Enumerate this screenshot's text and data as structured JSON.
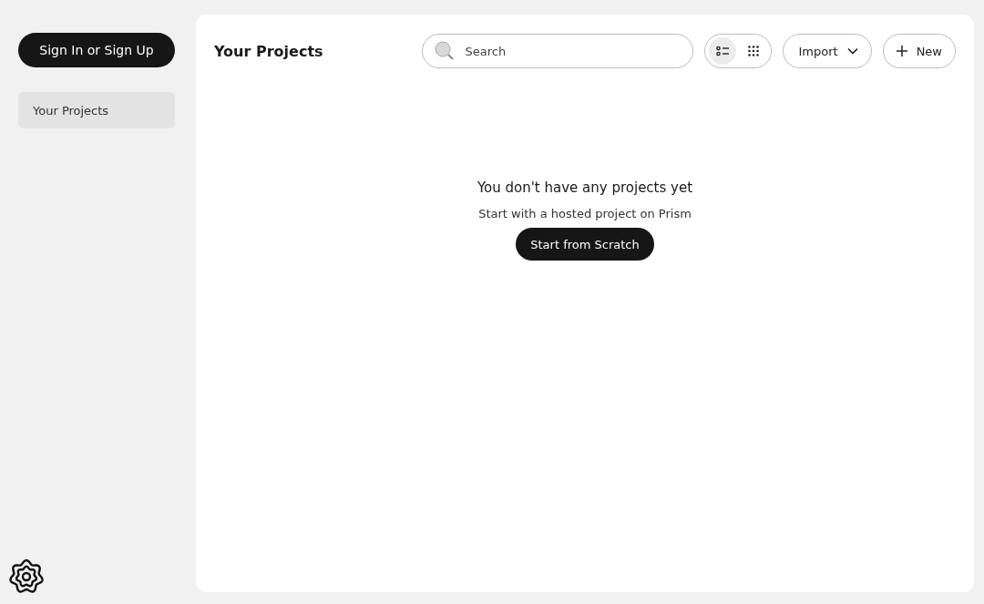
{
  "sidebar": {
    "sign_in_button": "Sign In or Sign Up",
    "items": [
      {
        "label": "Your Projects",
        "selected": true
      }
    ]
  },
  "header": {
    "title": "Your Projects",
    "search": {
      "placeholder": "Search"
    },
    "view_toggle": [
      {
        "kind": "list",
        "selected": true
      },
      {
        "kind": "grid",
        "selected": false
      }
    ],
    "import_button": "Import",
    "new_button": "New"
  },
  "empty_state": {
    "heading": "You don't have any projects yet",
    "text": "Start with a hosted project on Prism",
    "button": "Start from Scratch"
  }
}
